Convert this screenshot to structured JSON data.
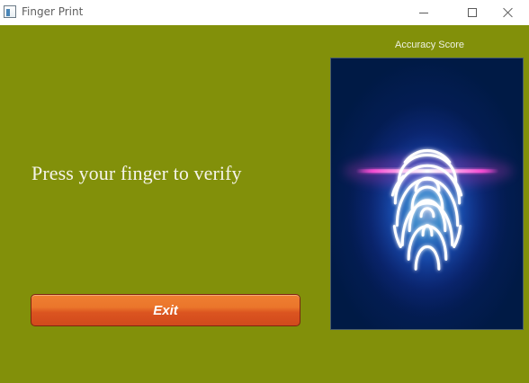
{
  "window": {
    "title": "Finger Print"
  },
  "main": {
    "prompt_text": "Press your finger to verify",
    "exit_button_label": "Exit",
    "accuracy_label": "Accuracy Score"
  },
  "icons": {
    "app": "app-icon",
    "minimize": "minimize-icon",
    "maximize": "maximize-icon",
    "close": "close-icon",
    "fingerprint": "fingerprint-icon"
  },
  "colors": {
    "background": "#82900a",
    "button": "#e36426",
    "scanner_background": "#001a45",
    "scan_line": "#ff4fd8",
    "fingerprint_glow": "#3a8cff"
  }
}
